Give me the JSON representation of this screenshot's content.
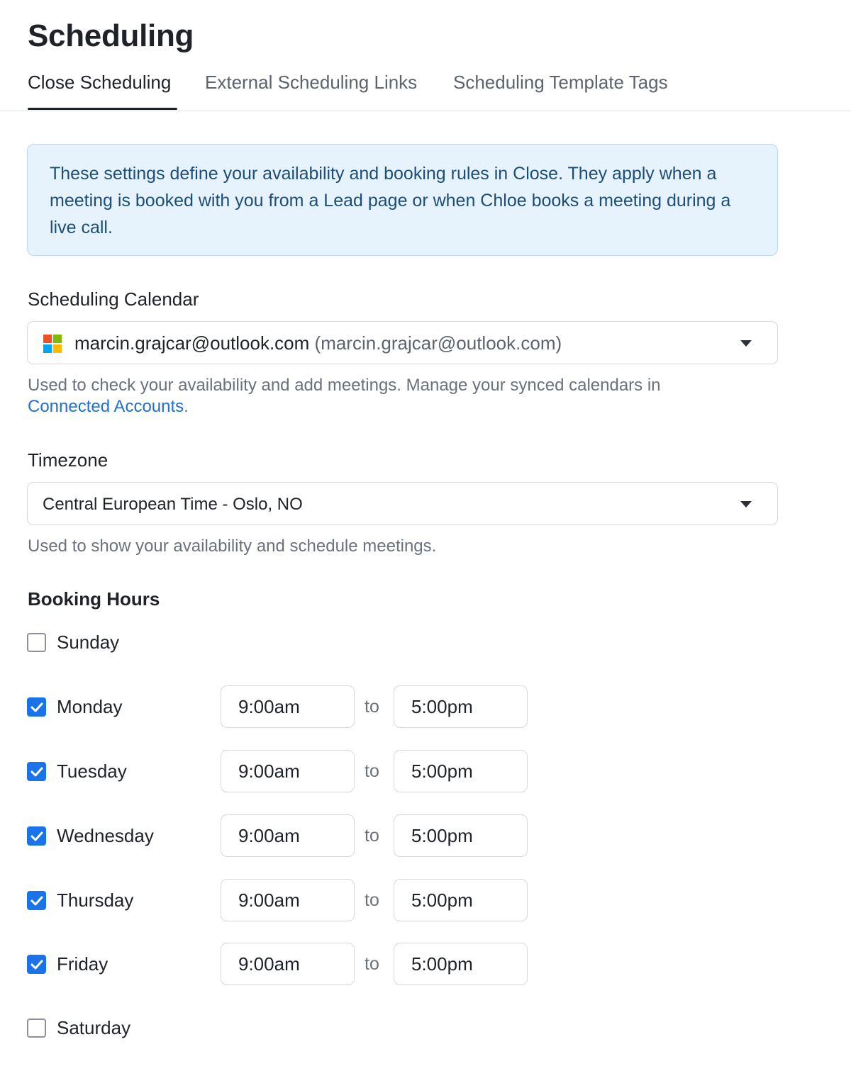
{
  "page": {
    "title": "Scheduling"
  },
  "tabs": [
    {
      "label": "Close Scheduling",
      "active": true
    },
    {
      "label": "External Scheduling Links",
      "active": false
    },
    {
      "label": "Scheduling Template Tags",
      "active": false
    }
  ],
  "info": {
    "text": "These settings define your availability and booking rules in Close. They apply when a meeting is booked with you from a Lead page or when Chloe books a meeting during a live call."
  },
  "calendar": {
    "label": "Scheduling Calendar",
    "selected_name": "marcin.grajcar@outlook.com",
    "selected_detail": "(marcin.grajcar@outlook.com)",
    "icon": "microsoft-icon",
    "help_text": "Used to check your availability and add meetings. Manage your synced calendars in",
    "help_link": "Connected Accounts",
    "help_suffix": "."
  },
  "timezone": {
    "label": "Timezone",
    "selected": "Central European Time - Oslo, NO",
    "help_text": "Used to show your availability and schedule meetings."
  },
  "booking_hours": {
    "label": "Booking Hours",
    "separator": "to",
    "days": [
      {
        "name": "Sunday",
        "checked": false
      },
      {
        "name": "Monday",
        "checked": true,
        "start": "9:00am",
        "end": "5:00pm"
      },
      {
        "name": "Tuesday",
        "checked": true,
        "start": "9:00am",
        "end": "5:00pm"
      },
      {
        "name": "Wednesday",
        "checked": true,
        "start": "9:00am",
        "end": "5:00pm"
      },
      {
        "name": "Thursday",
        "checked": true,
        "start": "9:00am",
        "end": "5:00pm"
      },
      {
        "name": "Friday",
        "checked": true,
        "start": "9:00am",
        "end": "5:00pm"
      },
      {
        "name": "Saturday",
        "checked": false
      }
    ]
  },
  "colors": {
    "accent": "#1a73e8",
    "info_bg": "#e6f2fc",
    "info_text": "#1c4e78",
    "link": "#1f6fd6",
    "ms_red": "#f25022",
    "ms_green": "#7fba00",
    "ms_blue": "#00a4ef",
    "ms_yellow": "#ffb900"
  }
}
